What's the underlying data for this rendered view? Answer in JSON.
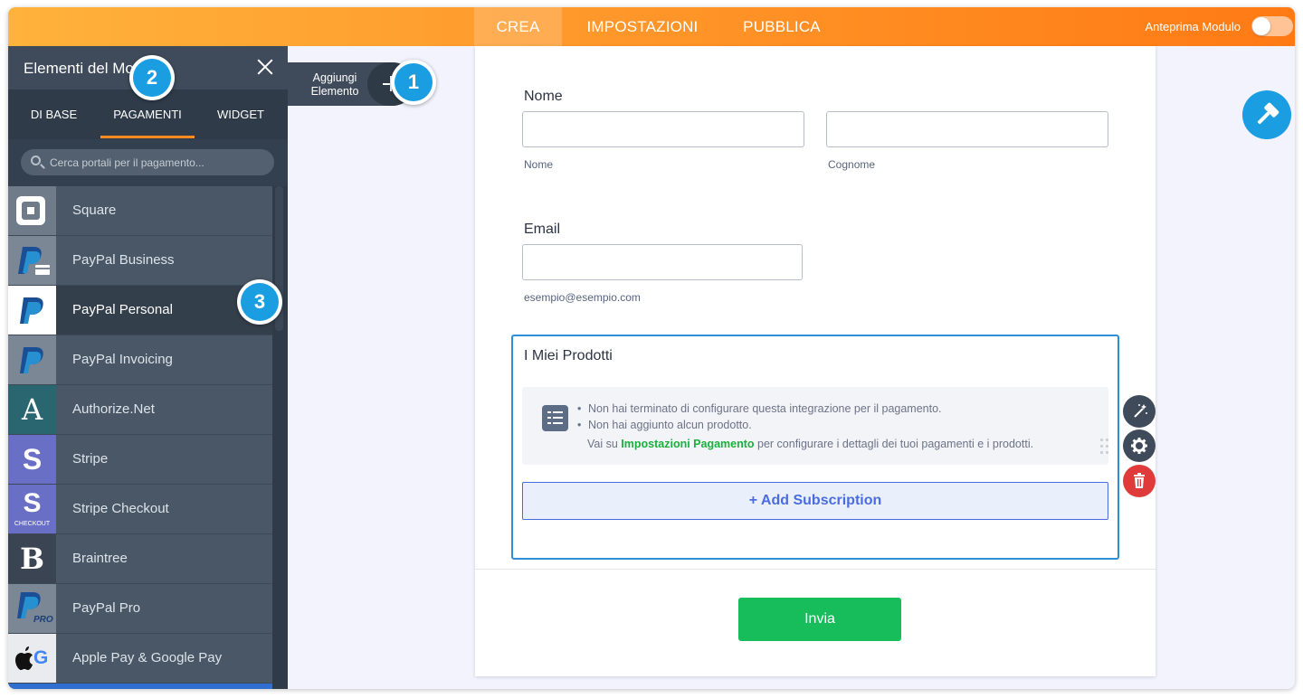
{
  "topbar": {
    "tabs": [
      {
        "label": "CREA",
        "active": true
      },
      {
        "label": "IMPOSTAZIONI",
        "active": false
      },
      {
        "label": "PUBBLICA",
        "active": false
      }
    ],
    "preview_label": "Anteprima Modulo",
    "preview_enabled": false
  },
  "panel": {
    "title": "Elementi del Modulo",
    "subtabs": [
      {
        "label": "DI BASE",
        "active": false
      },
      {
        "label": "PAGAMENTI",
        "active": true
      },
      {
        "label": "WIDGET",
        "active": false
      }
    ],
    "search_placeholder": "Cerca portali per il pagamento...",
    "items": [
      {
        "label": "Square",
        "icon": "square-logo-icon"
      },
      {
        "label": "PayPal Business",
        "icon": "paypal-business-icon"
      },
      {
        "label": "PayPal Personal",
        "icon": "paypal-icon",
        "selected": true
      },
      {
        "label": "PayPal Invoicing",
        "icon": "paypal-invoicing-icon"
      },
      {
        "label": "Authorize.Net",
        "icon": "authorize-net-icon"
      },
      {
        "label": "Stripe",
        "icon": "stripe-icon"
      },
      {
        "label": "Stripe Checkout",
        "icon": "stripe-checkout-icon"
      },
      {
        "label": "Braintree",
        "icon": "braintree-icon"
      },
      {
        "label": "PayPal Pro",
        "icon": "paypal-pro-icon"
      },
      {
        "label": "Apple Pay & Google Pay",
        "icon": "apple-google-pay-icon"
      }
    ],
    "icon_texts": {
      "authorize": "A",
      "stripe": "S",
      "stripe_checkout": "S",
      "checkout": "CHECKOUT",
      "braintree": "B",
      "pro": "PRO",
      "google": "G"
    }
  },
  "add_element": {
    "label": "Aggiungi Elemento"
  },
  "badges": [
    "1",
    "2",
    "3"
  ],
  "form": {
    "name": {
      "label": "Nome",
      "first_sublabel": "Nome",
      "last_sublabel": "Cognome"
    },
    "email": {
      "label": "Email",
      "sublabel": "esempio@esempio.com"
    },
    "products": {
      "title": "I Miei Prodotti",
      "notice_1": "Non hai terminato di configurare questa integrazione per il pagamento.",
      "notice_2": "Non hai aggiunto alcun prodotto.",
      "goto_prefix": "Vai su ",
      "goto_link": "Impostazioni Pagamento",
      "goto_suffix": " per configurare i dettagli dei tuoi pagamenti e i prodotti.",
      "add_subscription": "+ Add Subscription"
    },
    "submit_label": "Invia"
  },
  "colors": {
    "topbar_start": "#ffb23c",
    "topbar_end": "#ff7a14",
    "panel_bg": "#33404f",
    "accent_orange": "#ff8a1f",
    "badge_blue": "#1a9de1",
    "selected_border": "#2e8ed8",
    "link_green": "#18b13b",
    "submit_green": "#18bd5b",
    "delete_red": "#e03b3b"
  }
}
